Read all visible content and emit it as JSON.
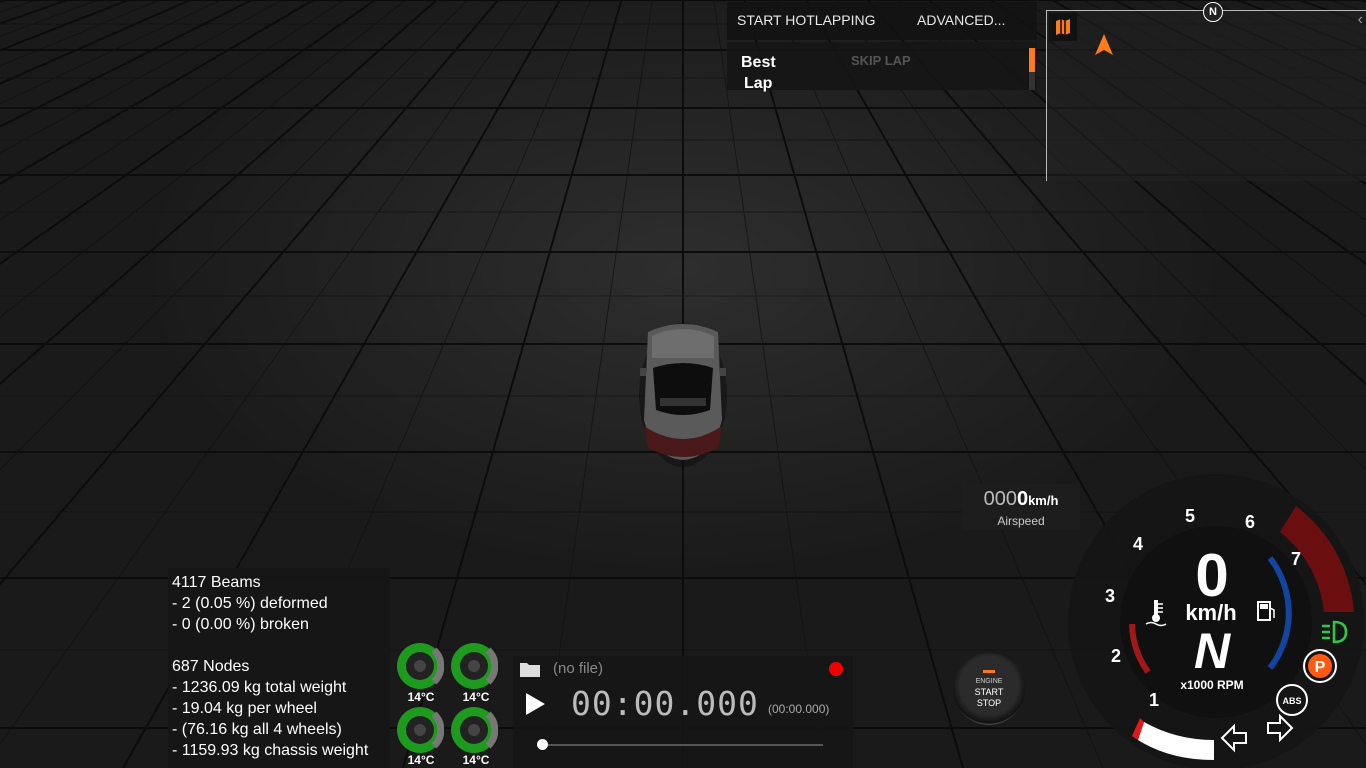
{
  "hotlapping": {
    "start_label": "START HOTLAPPING",
    "advanced_label": "ADVANCED...",
    "best_line1": "Best",
    "best_line2": "Lap",
    "skip_label": "SKIP LAP",
    "accent_color": "#ff7a1a"
  },
  "minimap": {
    "map_icon": "map-icon",
    "north_label": "N",
    "collapse_icon": "chevron-left-icon",
    "player_marker": "navigation-arrow-icon"
  },
  "airspeed": {
    "dim_digits": "000",
    "value_digit": "0",
    "unit": "km/h",
    "label": "Airspeed"
  },
  "beam_info": {
    "lines": [
      "4117 Beams",
      "- 2 (0.05 %) deformed",
      "- 0 (0.00 %) broken",
      "",
      "687 Nodes",
      "- 1236.09 kg total weight",
      "- 19.04 kg per wheel",
      "- (76.16 kg all 4 wheels)",
      "- 1159.93 kg chassis weight"
    ]
  },
  "tires": [
    {
      "temp": "14°C"
    },
    {
      "temp": "14°C"
    },
    {
      "temp": "14°C"
    },
    {
      "temp": "14°C"
    }
  ],
  "replay": {
    "file": "(no file)",
    "time": "00:00.000",
    "time_small": "(00:00.000)",
    "record_color": "#f20000",
    "progress": 0
  },
  "engine_button": {
    "line1": "ENGINE",
    "line2": "START",
    "line3": "STOP"
  },
  "gauge": {
    "speed": "0",
    "speed_unit": "km/h",
    "gear": "N",
    "rpm_label": "x1000 RPM",
    "rpm_ticks": [
      "1",
      "2",
      "3",
      "4",
      "5",
      "6",
      "7"
    ],
    "icons": [
      "coolant-temp-icon",
      "fuel-pump-icon",
      "headlight-icon",
      "parking-brake-icon",
      "abs-icon",
      "left-turn-signal-icon",
      "right-turn-signal-icon"
    ],
    "parking_label": "P",
    "abs_label": "ABS",
    "colors": {
      "redline": "#6a0e10",
      "temp": "#a01818",
      "fuel": "#1245a0",
      "headlight": "#2ec84a",
      "parking": "#ff5a14"
    }
  }
}
